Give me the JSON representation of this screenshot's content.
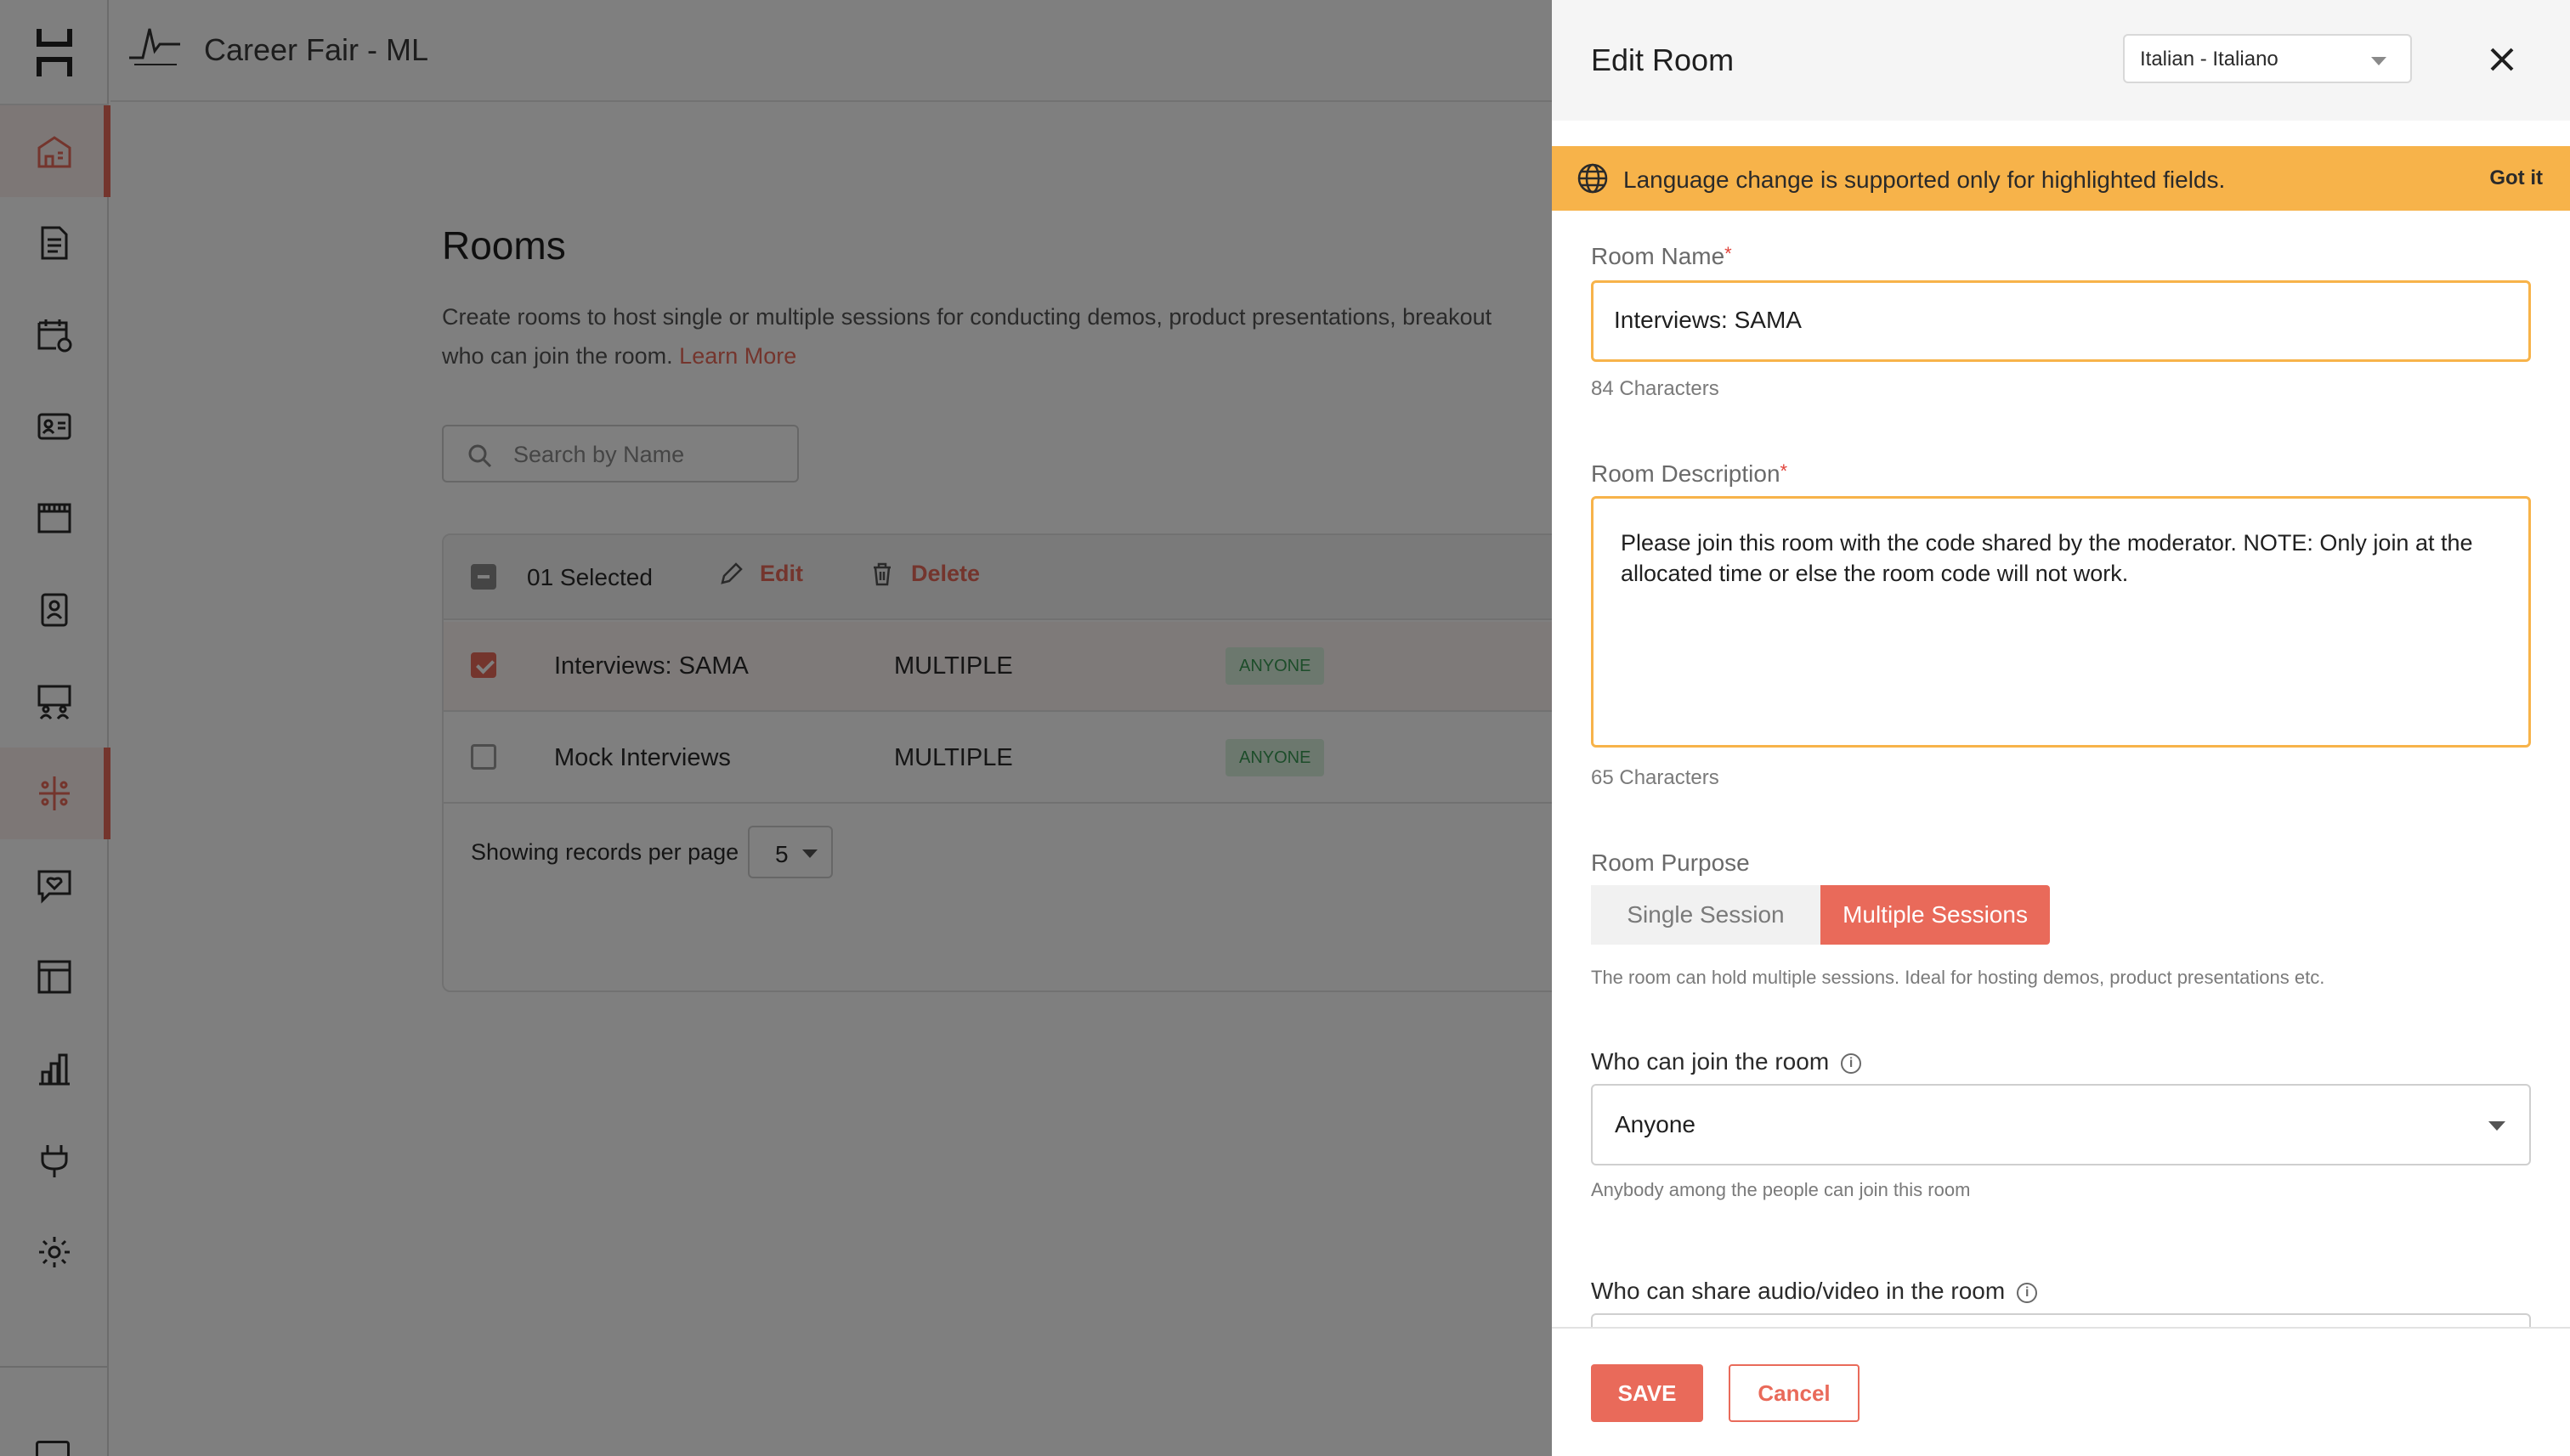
{
  "header": {
    "event_title": "Career Fair - ML"
  },
  "sidebar": {
    "items": [
      {
        "icon": "building-icon",
        "active": true
      },
      {
        "icon": "document-icon",
        "active": false
      },
      {
        "icon": "calendar-icon",
        "active": false
      },
      {
        "icon": "id-card-icon",
        "active": false
      },
      {
        "icon": "booth-icon",
        "active": false
      },
      {
        "icon": "badge-icon",
        "active": false
      },
      {
        "icon": "people-screen-icon",
        "active": false
      },
      {
        "icon": "rooms-icon",
        "active": true
      },
      {
        "icon": "chat-heart-icon",
        "active": false
      },
      {
        "icon": "layout-icon",
        "active": false
      },
      {
        "icon": "bar-chart-icon",
        "active": false
      },
      {
        "icon": "plug-icon",
        "active": false
      },
      {
        "icon": "gear-icon",
        "active": false
      }
    ]
  },
  "rooms_page": {
    "title": "Rooms",
    "description": "Create rooms to host single or multiple sessions for conducting demos, product presentations, breakout",
    "description_line2": "who can join the room.",
    "learn_more": "Learn More",
    "search_placeholder": "Search by Name",
    "selected_count": "01 Selected",
    "edit_label": "Edit",
    "delete_label": "Delete",
    "rows": [
      {
        "name": "Interviews: SAMA",
        "type": "MULTIPLE",
        "access": "ANYONE",
        "checked": true
      },
      {
        "name": "Mock Interviews",
        "type": "MULTIPLE",
        "access": "ANYONE",
        "checked": false
      }
    ],
    "records_label": "Showing records per page",
    "records_per_page": "5"
  },
  "drawer": {
    "title": "Edit Room",
    "language": "Italian - Italiano",
    "notice": "Language change is supported only for highlighted fields.",
    "notice_action": "Got it",
    "room_name_label": "Room Name",
    "room_name_value": "Interviews: SAMA",
    "room_name_hint": "84 Characters",
    "room_desc_label": "Room Description",
    "room_desc_value": "Please join this room with the code shared by the moderator. NOTE: Only join at the allocated time or else the room code will not work.",
    "room_desc_hint": "65 Characters",
    "purpose_label": "Room Purpose",
    "purpose_single": "Single Session",
    "purpose_multiple": "Multiple Sessions",
    "purpose_hint": "The room can hold multiple sessions. Ideal for hosting demos, product presentations etc.",
    "join_label": "Who can join the room",
    "join_value": "Anyone",
    "join_hint": "Anybody among the people can join this room",
    "share_label": "Who can share audio/video in the room",
    "save_label": "SAVE",
    "cancel_label": "Cancel"
  },
  "colors": {
    "accent": "#e96a5a",
    "notice": "#f7b34a",
    "badge_bg": "#d8f0dd",
    "badge_text": "#3b9a55"
  }
}
